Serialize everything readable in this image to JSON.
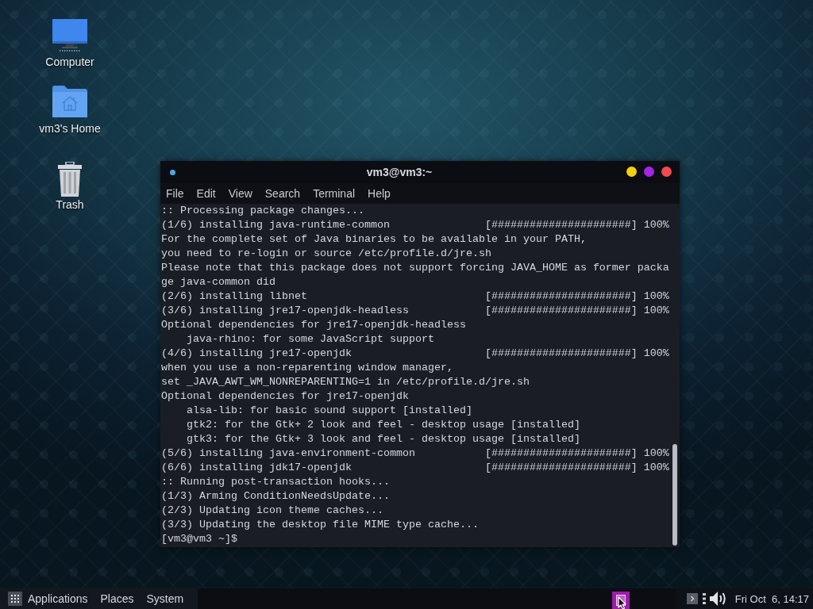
{
  "desktop": {
    "icons": [
      {
        "kind": "computer",
        "label": "Computer"
      },
      {
        "kind": "home",
        "label": "vm3's Home"
      },
      {
        "kind": "trash",
        "label": "Trash"
      }
    ]
  },
  "terminal": {
    "title": "vm3@vm3:~",
    "menu": [
      "File",
      "Edit",
      "View",
      "Search",
      "Terminal",
      "Help"
    ],
    "lines": [
      ":: Processing package changes...",
      "(1/6) installing java-runtime-common               [######################] 100%",
      "For the complete set of Java binaries to be available in your PATH,",
      "you need to re-login or source /etc/profile.d/jre.sh",
      "Please note that this package does not support forcing JAVA_HOME as former packa",
      "ge java-common did",
      "(2/6) installing libnet                            [######################] 100%",
      "(3/6) installing jre17-openjdk-headless            [######################] 100%",
      "Optional dependencies for jre17-openjdk-headless",
      "    java-rhino: for some JavaScript support",
      "(4/6) installing jre17-openjdk                     [######################] 100%",
      "when you use a non-reparenting window manager,",
      "set _JAVA_AWT_WM_NONREPARENTING=1 in /etc/profile.d/jre.sh",
      "Optional dependencies for jre17-openjdk",
      "    alsa-lib: for basic sound support [installed]",
      "    gtk2: for the Gtk+ 2 look and feel - desktop usage [installed]",
      "    gtk3: for the Gtk+ 3 look and feel - desktop usage [installed]",
      "(5/6) installing java-environment-common           [######################] 100%",
      "(6/6) installing jdk17-openjdk                     [######################] 100%",
      ":: Running post-transaction hooks...",
      "(1/3) Arming ConditionNeedsUpdate...",
      "(2/3) Updating icon theme caches...",
      "(3/3) Updating the desktop file MIME type cache...",
      "[vm3@vm3 ~]$"
    ]
  },
  "panel": {
    "menus": [
      "Applications",
      "Places",
      "System"
    ],
    "clock": "Fri Oct  6, 14:17"
  }
}
